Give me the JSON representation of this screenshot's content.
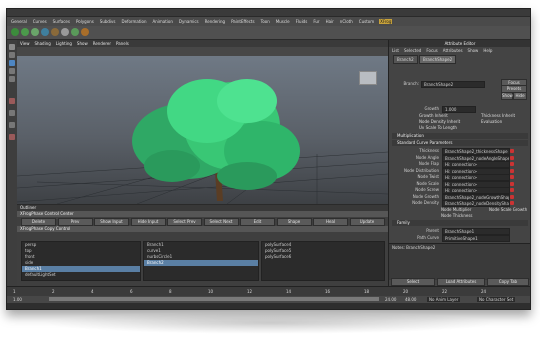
{
  "menubar": [
    "General",
    "Curves",
    "Surfaces",
    "Polygons",
    "Subdivs",
    "Deformation",
    "Animation",
    "Dynamics",
    "Rendering",
    "PaintEffects",
    "Toon",
    "Muscle",
    "Fluids",
    "Fur",
    "Hair",
    "nCloth",
    "Custom",
    "XFrog"
  ],
  "active_shelf": "XFrog",
  "panel_menu": [
    "View",
    "Shading",
    "Lighting",
    "Show",
    "Renderer",
    "Panels"
  ],
  "outliner": {
    "title": "Outliner",
    "section1": "XFrogPhase Control Center",
    "buttons1": [
      "Delete",
      "Prev",
      "Show Input",
      "Hide Input",
      "Select Prev",
      "Select Next",
      "Edit",
      "Shape",
      "Heal",
      "Update"
    ],
    "section2": "XFrogPhase Copy Control",
    "col1_items": [
      "persp",
      "top",
      "front",
      "side",
      "Branch1",
      "defaultLightSet"
    ],
    "col2_items": [
      "Branch1",
      "curve1",
      "nurbsCircle1",
      "Branch2"
    ],
    "col3_items": [
      "polySurface4",
      "polySurface5",
      "polySurface6"
    ]
  },
  "attr": {
    "title": "Attribute Editor",
    "menu": [
      "List",
      "Selected",
      "Focus",
      "Attributes",
      "Show",
      "Help"
    ],
    "tabs": [
      "Branch2",
      "BranchShape2"
    ],
    "branch_label": "Branch:",
    "branch_value": "BranchShape2",
    "focus_btn": "Focus",
    "presets_btn": "Presets",
    "show_btn": "Show",
    "hide_btn": "Hide",
    "growth_label": "Growth",
    "growth_value": "1.000",
    "checks": [
      "Growth Inherit",
      "Thickness Inherit",
      "Node Density Inherit",
      "Evaluation",
      "Uv Scale To Length"
    ],
    "sec_mult": "Multiplication",
    "sec_std": "Standard Curve Parameters",
    "params": [
      {
        "label": "Thickness",
        "value": "BranchShape2_thicknessShape"
      },
      {
        "label": "Node Angle",
        "value": "BranchShape2_nodeAngleShape"
      },
      {
        "label": "Node Flap",
        "value": "Hi: connection>"
      },
      {
        "label": "Node Distribution",
        "value": "Hi: connection>"
      },
      {
        "label": "Node Twist",
        "value": "Hi: connection>"
      },
      {
        "label": "Node Scale",
        "value": "Hi: connection>"
      },
      {
        "label": "Node Screw",
        "value": "Hi: connection>"
      },
      {
        "label": "Node Growth",
        "value": "BranchShape2_nodeGrowthShape"
      },
      {
        "label": "Node Density",
        "value": "BranchShape2_nodeDensityShape"
      }
    ],
    "node_checks": [
      "Node Multiplier",
      "Node Scale Growth",
      "Node Thickness"
    ],
    "sec_family": "Family",
    "parent_label": "Parent",
    "parent_value": "BranchShape1",
    "path_label": "Path Curve",
    "path_value": "PrimitiveShape1",
    "notes": "Notes: BranchShape2",
    "bottom_buttons": [
      "Select",
      "Load Attributes",
      "Copy Tab"
    ]
  },
  "timeline": {
    "ticks": [
      "1",
      "2",
      "4",
      "6",
      "8",
      "10",
      "12",
      "14",
      "16",
      "18",
      "20",
      "22",
      "24"
    ],
    "range_start": "1.00",
    "range_end": "24.00",
    "end_time": "48.00",
    "anim_layer": "No Anim Layer",
    "char_set": "No Character Set"
  },
  "colors": {
    "accent": "#c8a23a",
    "selection": "#5a7fa4",
    "foliage": "#3ee37a"
  }
}
